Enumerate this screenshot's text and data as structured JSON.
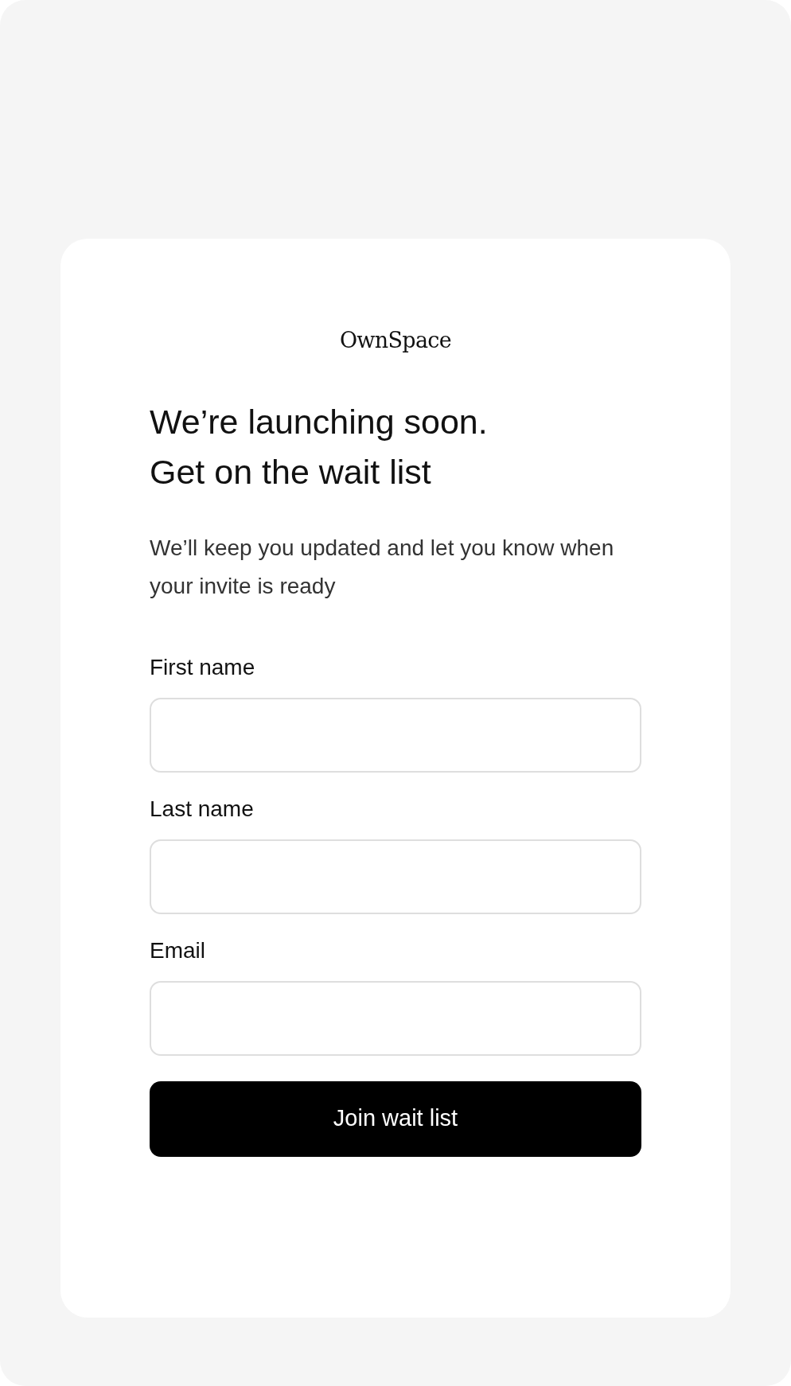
{
  "logo": "OwnSpace",
  "heading": [
    "We’re launching soon.",
    "Get on the wait list"
  ],
  "subtitle": "We’ll keep you updated and let you know when your invite is ready",
  "fields": [
    {
      "label": "First name"
    },
    {
      "label": "Last name"
    },
    {
      "label": "Email"
    }
  ],
  "button": "Join wait list"
}
